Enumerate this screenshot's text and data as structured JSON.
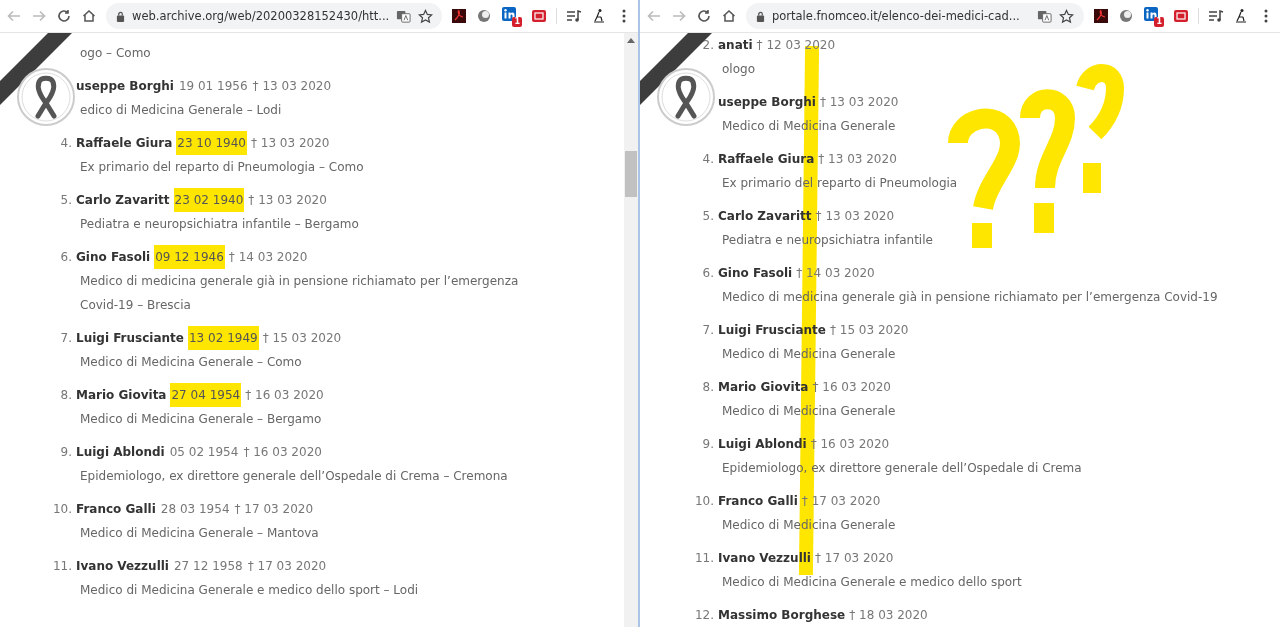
{
  "windows": [
    {
      "url": "web.archive.org/web/20200328152430/htt...",
      "extension_badge": "1",
      "scrollbar": true,
      "annotations": false,
      "entries": [
        {
          "description": "ogo – Como"
        },
        {
          "name": "useppe Borghi",
          "birth": "19 01 1956",
          "birth_highlighted": false,
          "death": "† 13 03 2020",
          "description": "edico di Medicina Generale  – Lodi"
        },
        {
          "number": "4.",
          "name": "Raffaele Giura",
          "birth": "23 10 1940",
          "birth_highlighted": true,
          "death": "† 13 03 2020",
          "description": "Ex primario del reparto di Pneumologia – Como"
        },
        {
          "number": "5.",
          "name": "Carlo Zavaritt",
          "birth": "23 02 1940",
          "birth_highlighted": true,
          "death": "† 13 03 2020",
          "description": "Pediatra e neuropsichiatra infantile – Bergamo"
        },
        {
          "number": "6.",
          "name": "Gino Fasoli",
          "birth": "09 12 1946",
          "birth_highlighted": true,
          "death": "† 14 03 2020",
          "description": "Medico di medicina generale già in pensione richiamato per l’emergenza Covid-19 – Brescia"
        },
        {
          "number": "7.",
          "name": "Luigi Frusciante",
          "birth": "13 02 1949",
          "birth_highlighted": true,
          "death": "† 15 03 2020",
          "description": "Medico di Medicina Generale  – Como"
        },
        {
          "number": "8.",
          "name": "Mario Giovita",
          "birth": "27 04 1954",
          "birth_highlighted": true,
          "death": "† 16 03 2020",
          "description": "Medico di Medicina Generale  – Bergamo"
        },
        {
          "number": "9.",
          "name": "Luigi Ablondi",
          "birth": "05 02 1954",
          "birth_highlighted": false,
          "death": "† 16 03 2020",
          "description": "Epidemiologo, ex direttore generale dell’Ospedale di Crema – Cremona"
        },
        {
          "number": "10.",
          "name": "Franco Galli",
          "birth": "28 03 1954",
          "birth_highlighted": false,
          "death": "† 17 03 2020",
          "description": "Medico di Medicina Generale  – Mantova"
        },
        {
          "number": "11.",
          "name": "Ivano Vezzulli",
          "birth": "27 12 1958",
          "birth_highlighted": false,
          "death": "† 17 03 2020",
          "description": "Medico di Medicina Generale e medico dello sport – Lodi"
        }
      ]
    },
    {
      "url": "portale.fnomceo.it/elenco-dei-medici-cad...",
      "extension_badge": "1",
      "scrollbar": false,
      "annotations": true,
      "entries": [
        {
          "number": "2.",
          "name": "anati",
          "death": "† 12 03 2020",
          "description": "ologo"
        },
        {
          "name": "useppe Borghi",
          "death": "† 13 03 2020",
          "description": "Medico di Medicina Generale"
        },
        {
          "number": "4.",
          "name": "Raffaele Giura",
          "death": "† 13 03 2020",
          "description": "Ex primario del reparto di Pneumologia"
        },
        {
          "number": "5.",
          "name": "Carlo Zavaritt",
          "death": "† 13 03 2020",
          "description": "Pediatra e neuropsichiatra infantile"
        },
        {
          "number": "6.",
          "name": "Gino Fasoli",
          "death": "† 14 03 2020",
          "description": "Medico di medicina generale già in pensione richiamato per l’emergenza Covid-19"
        },
        {
          "number": "7.",
          "name": "Luigi Frusciante",
          "death": "† 15 03 2020",
          "description": "Medico di Medicina Generale"
        },
        {
          "number": "8.",
          "name": "Mario Giovita",
          "death": "† 16 03 2020",
          "description": "Medico di Medicina Generale"
        },
        {
          "number": "9.",
          "name": "Luigi Ablondi",
          "death": "† 16 03 2020",
          "description": "Epidemiologo, ex direttore generale dell’Ospedale di Crema"
        },
        {
          "number": "10.",
          "name": "Franco Galli",
          "death": "† 17 03 2020",
          "description": "Medico di Medicina Generale"
        },
        {
          "number": "11.",
          "name": "Ivano Vezzulli",
          "death": "† 17 03 2020",
          "description": "Medico di Medicina Generale e medico dello sport"
        },
        {
          "number": "12.",
          "name": "Massimo Borghese",
          "death": "† 18 03 2020"
        }
      ]
    }
  ]
}
